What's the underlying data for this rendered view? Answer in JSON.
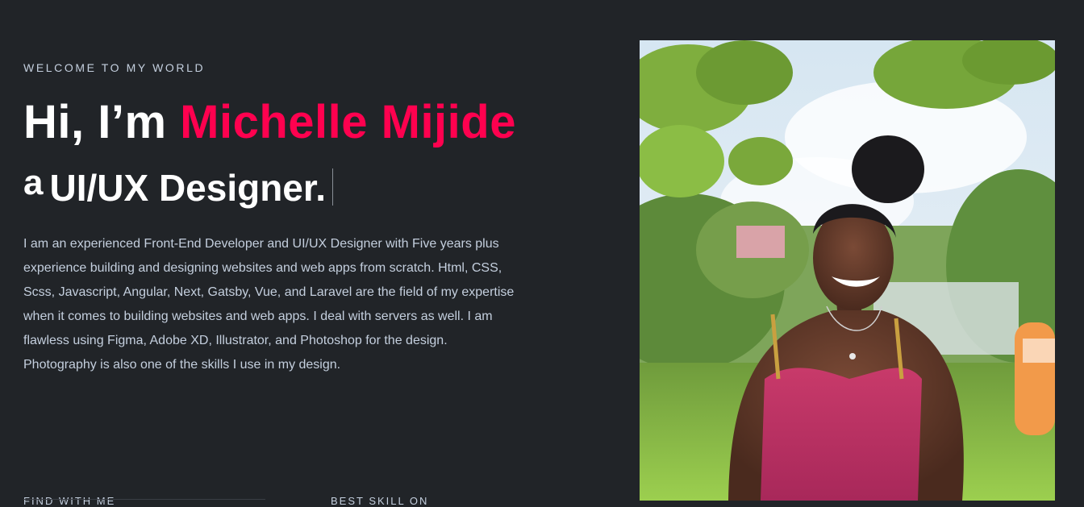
{
  "hero": {
    "welcome": "WELCOME TO MY WORLD",
    "greeting": "Hi, I’m ",
    "name": "Michelle Mijide",
    "article": "a",
    "role": "UI/UX Designer.",
    "bio": "I am an experienced Front-End Developer and UI/UX Designer with Five years plus experience building and designing websites and web apps from scratch. Html, CSS, Scss, Javascript, Angular, Next, Gatsby, Vue, and Laravel are the field of my expertise when it comes to building websites and web apps. I deal with servers as well. I am flawless using Figma, Adobe XD, Illustrator, and Photoshop for the design. Photography is also one of the skills I use in my design."
  },
  "footer": {
    "find_with_me": "FIND WITH ME",
    "best_skill": "BEST SKILL ON"
  },
  "colors": {
    "background": "#212428",
    "accent": "#ff014f",
    "body_text": "#c4cfde"
  }
}
